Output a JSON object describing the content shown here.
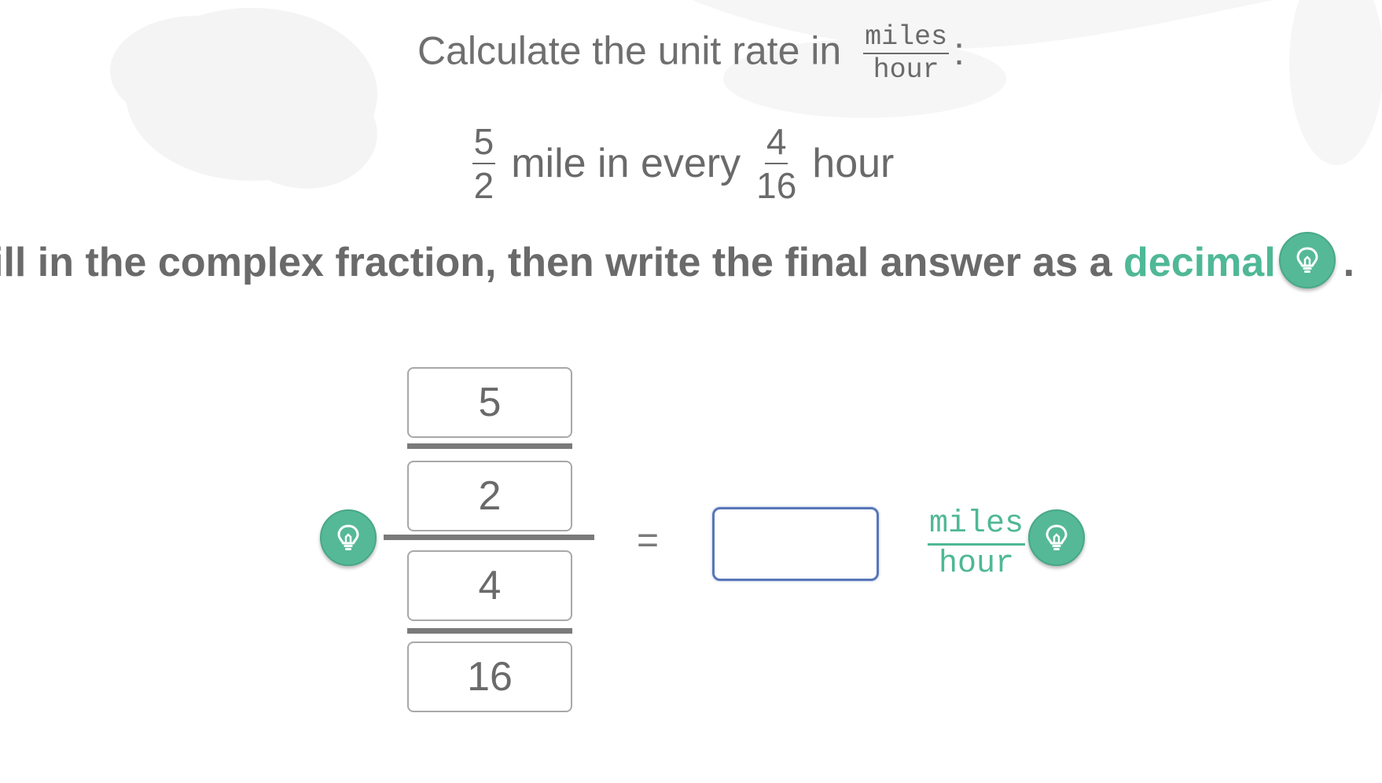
{
  "problem": {
    "title_prefix": "Calculate the unit rate in",
    "title_unit": {
      "numerator": "miles",
      "denominator": "hour"
    },
    "title_suffix": ":",
    "rate": {
      "first_fraction": {
        "numerator": "5",
        "denominator": "2"
      },
      "middle_text": "mile in every",
      "second_fraction": {
        "numerator": "4",
        "denominator": "16"
      },
      "end_text": "hour"
    }
  },
  "instruction": {
    "text": "ill in the complex fraction, then write the final answer as a ",
    "accent_word": "decimal",
    "end": ".",
    "hint_icon": "lightbulb-icon"
  },
  "complex_fraction": {
    "top_numerator": "5",
    "top_denominator": "2",
    "bottom_numerator": "4",
    "bottom_denominator": "16",
    "hint_icon": "lightbulb-icon"
  },
  "equals": "=",
  "answer": {
    "value": ""
  },
  "answer_unit": {
    "numerator": "miles",
    "denominator": "hour",
    "hint_icon": "lightbulb-icon"
  },
  "colors": {
    "accent": "#55b997",
    "text": "#6a6a6a",
    "answer_border": "#5877b8"
  }
}
